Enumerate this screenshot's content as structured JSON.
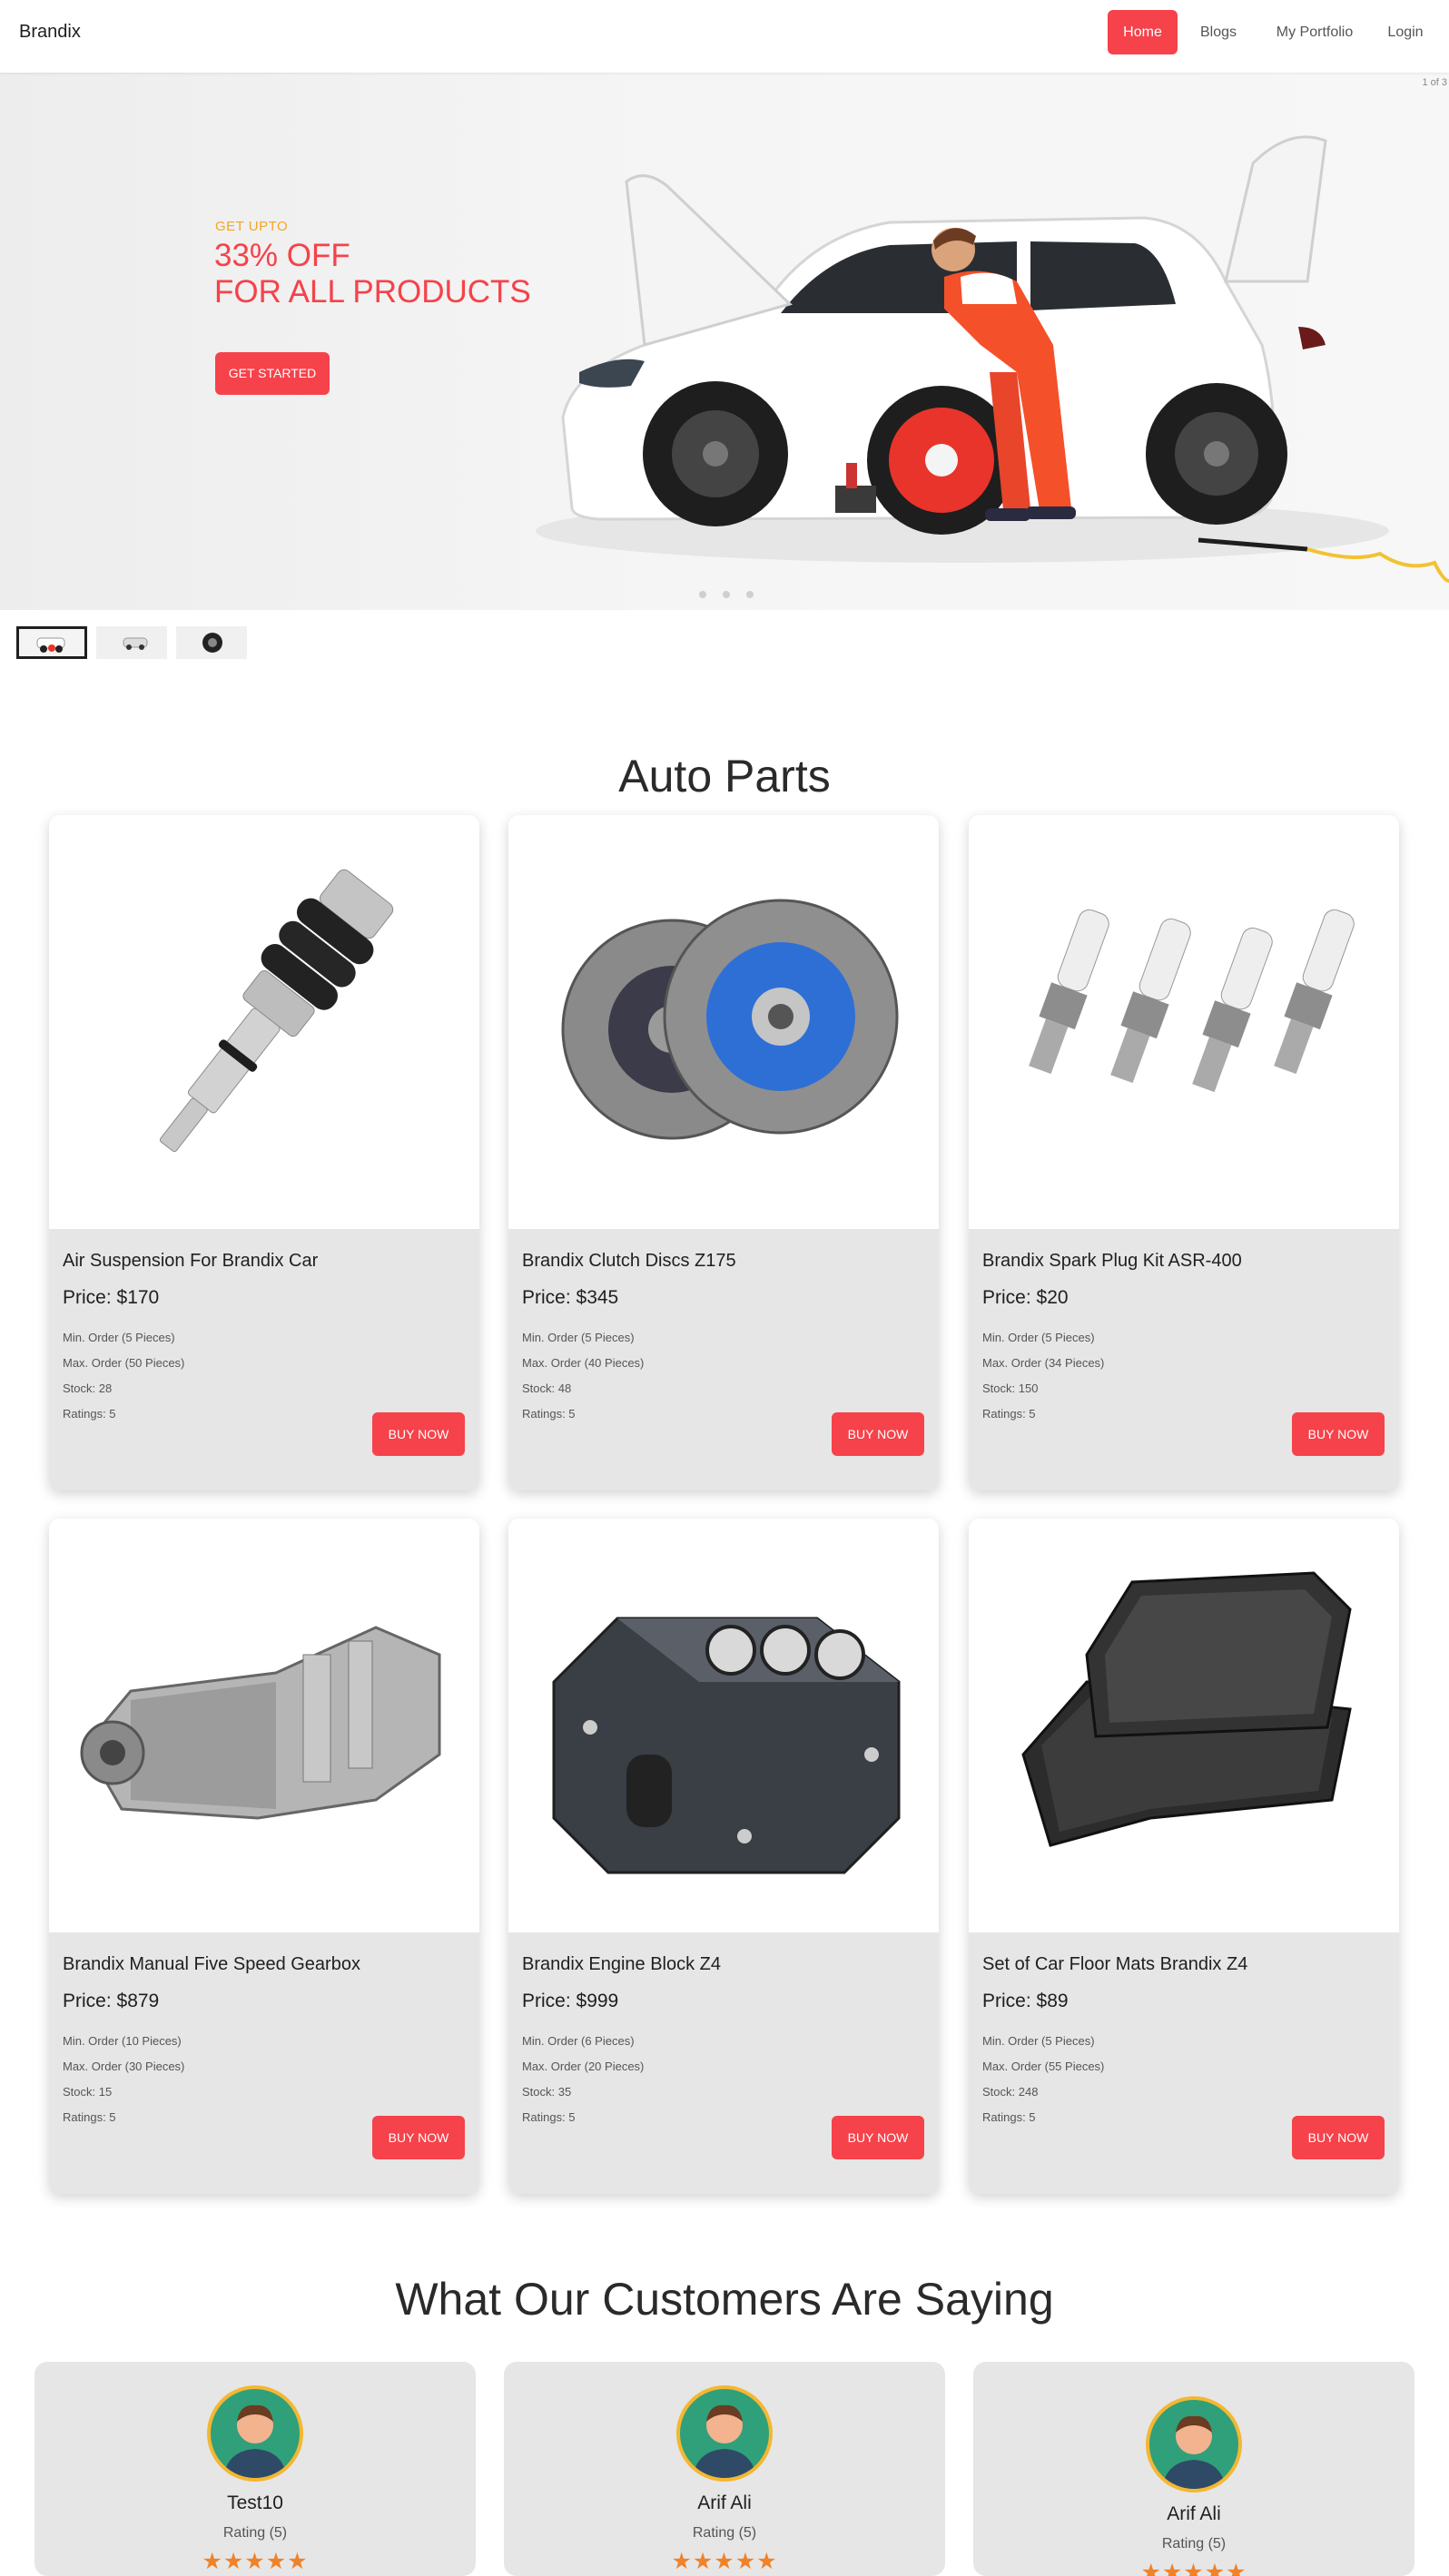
{
  "nav": {
    "brand": "Brandix",
    "items": [
      {
        "label": "Home",
        "active": true
      },
      {
        "label": "Blogs"
      },
      {
        "label": "My Portfolio"
      },
      {
        "label": "Login"
      }
    ]
  },
  "hero": {
    "counter": "1 of 3",
    "eyebrow": "GET UPTO",
    "title_line1": "33% OFF",
    "title_line2": "FOR ALL PRODUCTS",
    "cta": "GET STARTED",
    "slides": 3,
    "active_slide": 1
  },
  "parts": {
    "title": "Auto Parts",
    "products": [
      {
        "name": "Air Suspension For Brandix Car",
        "price": "Price: $170",
        "min": "Min. Order (5 Pieces)",
        "max": "Max. Order (50 Pieces)",
        "stock": "Stock: 28",
        "ratings": "Ratings: 5",
        "buy": "BUY NOW",
        "image_icon": "air-suspension-icon"
      },
      {
        "name": "Brandix Clutch Discs Z175",
        "price": "Price: $345",
        "min": "Min. Order (5 Pieces)",
        "max": "Max. Order (40 Pieces)",
        "stock": "Stock: 48",
        "ratings": "Ratings: 5",
        "buy": "BUY NOW",
        "image_icon": "clutch-disc-icon"
      },
      {
        "name": "Brandix Spark Plug Kit ASR-400",
        "price": "Price: $20",
        "min": "Min. Order (5 Pieces)",
        "max": "Max. Order (34 Pieces)",
        "stock": "Stock: 150",
        "ratings": "Ratings: 5",
        "buy": "BUY NOW",
        "image_icon": "spark-plug-icon"
      },
      {
        "name": "Brandix Manual Five Speed Gearbox",
        "price": "Price: $879",
        "min": "Min. Order (10 Pieces)",
        "max": "Max. Order (30 Pieces)",
        "stock": "Stock: 15",
        "ratings": "Ratings: 5",
        "buy": "BUY NOW",
        "image_icon": "gearbox-icon"
      },
      {
        "name": "Brandix Engine Block Z4",
        "price": "Price: $999",
        "min": "Min. Order (6 Pieces)",
        "max": "Max. Order (20 Pieces)",
        "stock": "Stock: 35",
        "ratings": "Ratings: 5",
        "buy": "BUY NOW",
        "image_icon": "engine-block-icon"
      },
      {
        "name": "Set of Car Floor Mats Brandix Z4",
        "price": "Price: $89",
        "min": "Min. Order (5 Pieces)",
        "max": "Max. Order (55 Pieces)",
        "stock": "Stock: 248",
        "ratings": "Ratings: 5",
        "buy": "BUY NOW",
        "image_icon": "floor-mats-icon"
      }
    ]
  },
  "reviews": {
    "title": "What Our Customers Are Saying",
    "items": [
      {
        "name": "Test10",
        "rating": "Rating (5)",
        "stars": 5
      },
      {
        "name": "Arif Ali",
        "rating": "Rating (5)",
        "stars": 5
      },
      {
        "name": "Arif Ali",
        "rating": "Rating (5)",
        "stars": 5
      }
    ]
  },
  "colors": {
    "accent": "#f6424a",
    "eyebrow": "#f5a623",
    "star": "#f0822a",
    "card_body": "#e6e6e6"
  }
}
